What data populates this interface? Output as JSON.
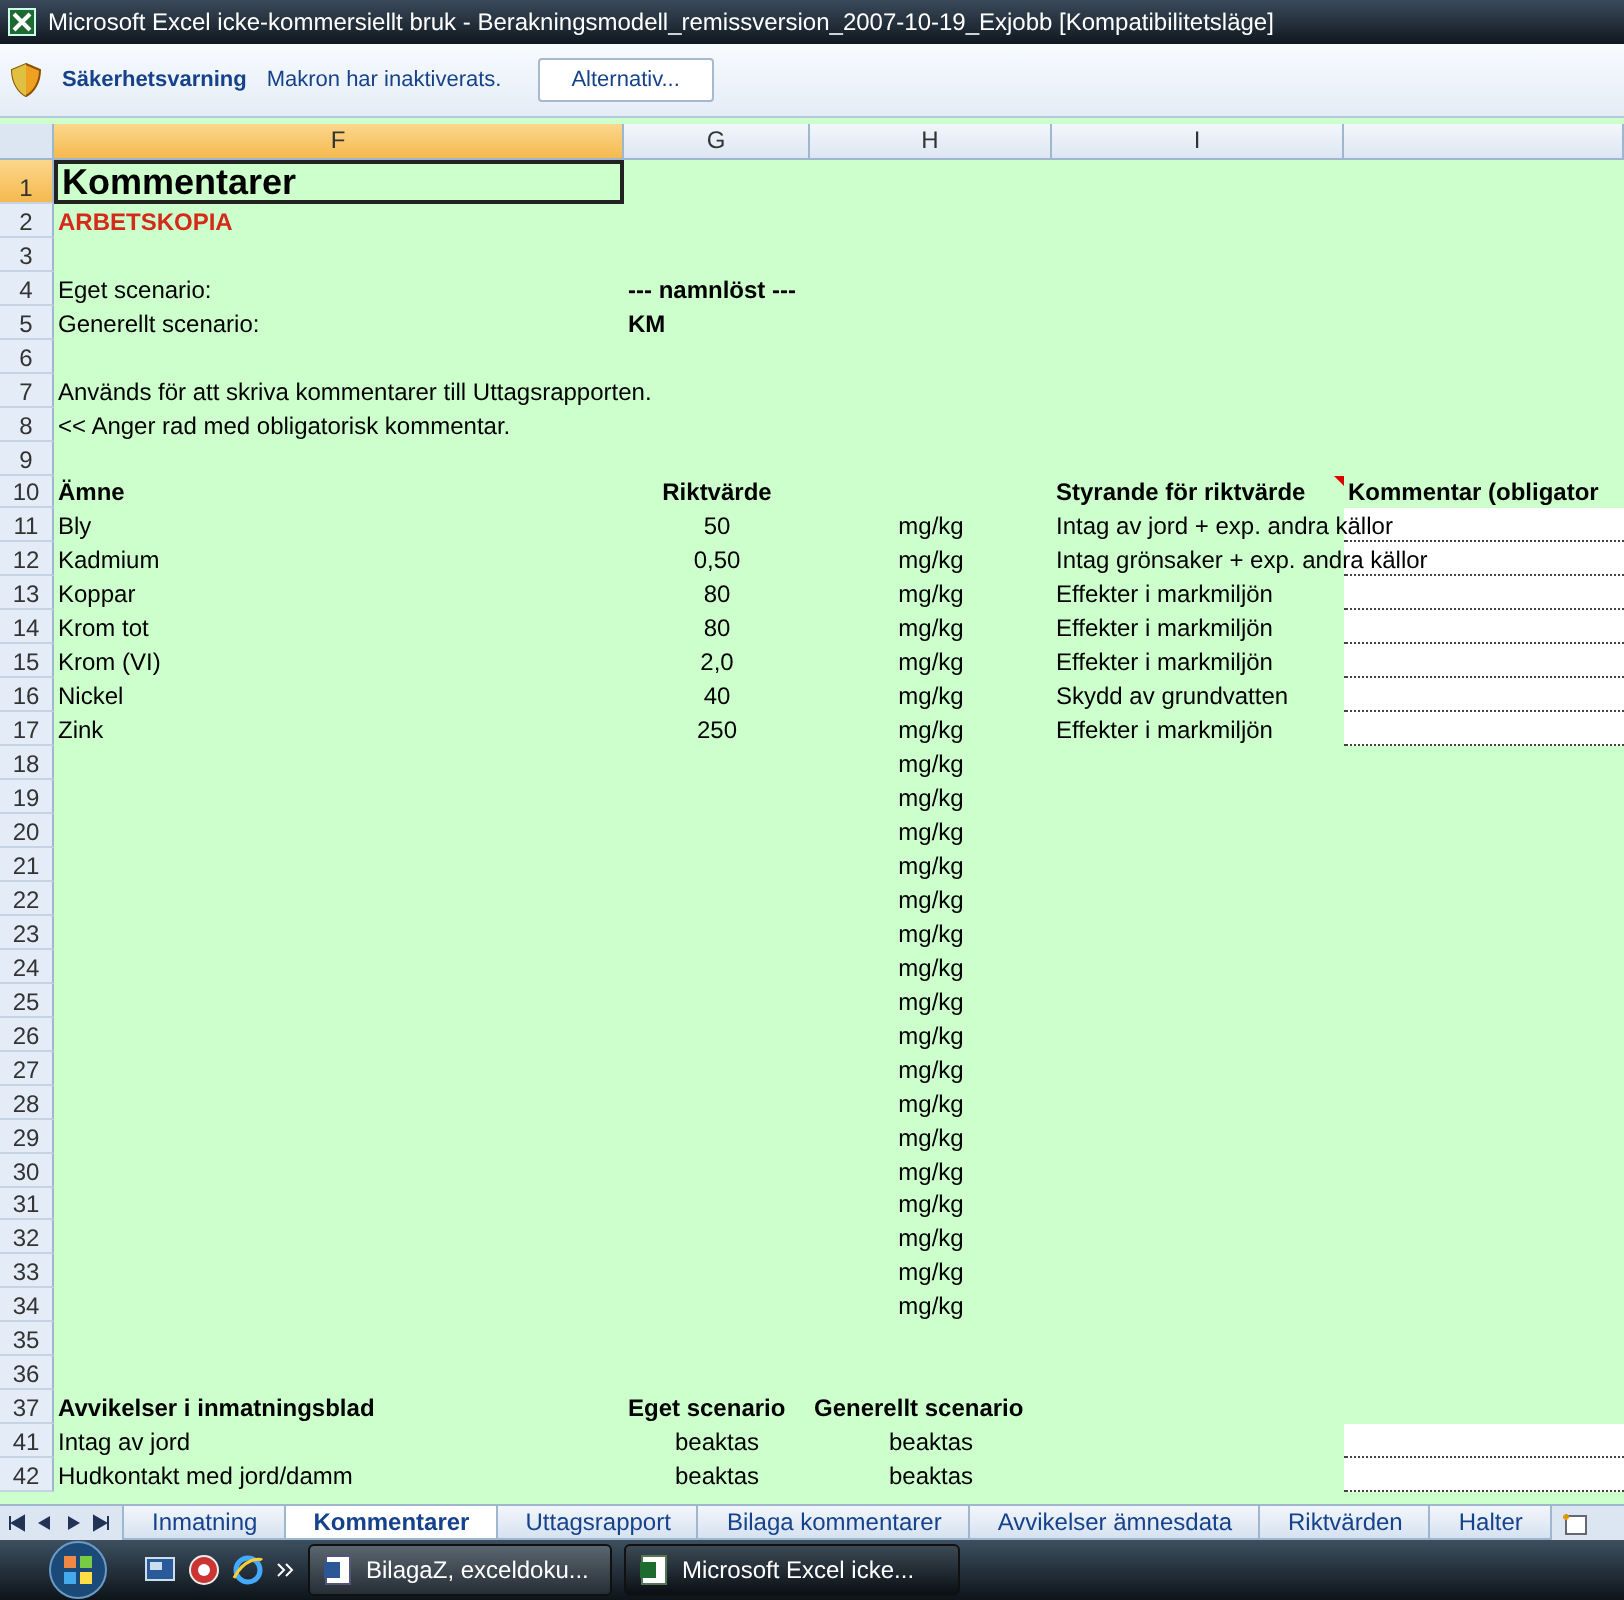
{
  "window": {
    "title": "Microsoft Excel icke-kommersiellt bruk - Berakningsmodell_remissversion_2007-10-19_Exjobb  [Kompatibilitetsläge]"
  },
  "security_bar": {
    "title": "Säkerhetsvarning",
    "message": "Makron har inaktiverats.",
    "button": "Alternativ..."
  },
  "columns": [
    {
      "label": "F",
      "selected": true
    },
    {
      "label": "G",
      "selected": false
    },
    {
      "label": "H",
      "selected": false
    },
    {
      "label": "I",
      "selected": false
    },
    {
      "selected": false
    }
  ],
  "rows": [
    {
      "n": "1",
      "kind": "title",
      "selected": true,
      "note": false,
      "comment_field": false,
      "f": "Kommentarer"
    },
    {
      "n": "2",
      "kind": "warning",
      "selected": false,
      "note": false,
      "comment_field": false,
      "f": "ARBETSKOPIA"
    },
    {
      "n": "3",
      "kind": "data",
      "selected": false,
      "note": false,
      "comment_field": false
    },
    {
      "n": "4",
      "kind": "scenario",
      "selected": false,
      "note": false,
      "comment_field": false,
      "f": "Eget scenario:",
      "g": "--- namnlöst ---"
    },
    {
      "n": "5",
      "kind": "scenario",
      "selected": false,
      "note": false,
      "comment_field": false,
      "f": "Generellt scenario:",
      "g": "KM"
    },
    {
      "n": "6",
      "kind": "data",
      "selected": false,
      "note": false,
      "comment_field": false
    },
    {
      "n": "7",
      "kind": "data",
      "selected": false,
      "note": false,
      "comment_field": false,
      "f": "Används för att skriva kommentarer till Uttagsrapporten."
    },
    {
      "n": "8",
      "kind": "data",
      "selected": false,
      "note": false,
      "comment_field": false,
      "f": "<< Anger rad med obligatorisk kommentar."
    },
    {
      "n": "9",
      "kind": "data",
      "selected": false,
      "note": false,
      "comment_field": false
    },
    {
      "n": "10",
      "kind": "header",
      "selected": false,
      "note": true,
      "comment_field": false,
      "f": "Ämne",
      "g": "Riktvärde",
      "i": "Styrande för riktvärde",
      "j": "Kommentar (obligator"
    },
    {
      "n": "11",
      "kind": "data",
      "selected": false,
      "note": false,
      "comment_field": true,
      "f": "Bly",
      "g": "50",
      "h": "mg/kg",
      "i": "Intag av jord + exp. andra källor"
    },
    {
      "n": "12",
      "kind": "data",
      "selected": false,
      "note": false,
      "comment_field": true,
      "f": "Kadmium",
      "g": "0,50",
      "h": "mg/kg",
      "i": "Intag grönsaker + exp. andra källor"
    },
    {
      "n": "13",
      "kind": "data",
      "selected": false,
      "note": false,
      "comment_field": true,
      "f": "Koppar",
      "g": "80",
      "h": "mg/kg",
      "i": "Effekter i markmiljön"
    },
    {
      "n": "14",
      "kind": "data",
      "selected": false,
      "note": false,
      "comment_field": true,
      "f": "Krom tot",
      "g": "80",
      "h": "mg/kg",
      "i": "Effekter i markmiljön"
    },
    {
      "n": "15",
      "kind": "data",
      "selected": false,
      "note": false,
      "comment_field": true,
      "f": "Krom (VI)",
      "g": "2,0",
      "h": "mg/kg",
      "i": "Effekter i markmiljön"
    },
    {
      "n": "16",
      "kind": "data",
      "selected": false,
      "note": false,
      "comment_field": true,
      "f": "Nickel",
      "g": "40",
      "h": "mg/kg",
      "i": "Skydd av grundvatten"
    },
    {
      "n": "17",
      "kind": "data",
      "selected": false,
      "note": false,
      "comment_field": true,
      "f": "Zink",
      "g": "250",
      "h": "mg/kg",
      "i": "Effekter i markmiljön"
    },
    {
      "n": "18",
      "kind": "data",
      "selected": false,
      "note": false,
      "comment_field": false,
      "h": "mg/kg"
    },
    {
      "n": "19",
      "kind": "data",
      "selected": false,
      "note": false,
      "comment_field": false,
      "h": "mg/kg"
    },
    {
      "n": "20",
      "kind": "data",
      "selected": false,
      "note": false,
      "comment_field": false,
      "h": "mg/kg"
    },
    {
      "n": "21",
      "kind": "data",
      "selected": false,
      "note": false,
      "comment_field": false,
      "h": "mg/kg"
    },
    {
      "n": "22",
      "kind": "data",
      "selected": false,
      "note": false,
      "comment_field": false,
      "h": "mg/kg"
    },
    {
      "n": "23",
      "kind": "data",
      "selected": false,
      "note": false,
      "comment_field": false,
      "h": "mg/kg"
    },
    {
      "n": "24",
      "kind": "data",
      "selected": false,
      "note": false,
      "comment_field": false,
      "h": "mg/kg"
    },
    {
      "n": "25",
      "kind": "data",
      "selected": false,
      "note": false,
      "comment_field": false,
      "h": "mg/kg"
    },
    {
      "n": "26",
      "kind": "data",
      "selected": false,
      "note": false,
      "comment_field": false,
      "h": "mg/kg"
    },
    {
      "n": "27",
      "kind": "data",
      "selected": false,
      "note": false,
      "comment_field": false,
      "h": "mg/kg"
    },
    {
      "n": "28",
      "kind": "data",
      "selected": false,
      "note": false,
      "comment_field": false,
      "h": "mg/kg"
    },
    {
      "n": "29",
      "kind": "data",
      "selected": false,
      "note": false,
      "comment_field": false,
      "h": "mg/kg"
    },
    {
      "n": "30",
      "kind": "data",
      "selected": false,
      "note": false,
      "comment_field": false,
      "h": "mg/kg"
    },
    {
      "n": "31",
      "kind": "data",
      "selected": false,
      "note": false,
      "comment_field": false,
      "h": "mg/kg"
    },
    {
      "n": "32",
      "kind": "data",
      "selected": false,
      "note": false,
      "comment_field": false,
      "h": "mg/kg"
    },
    {
      "n": "33",
      "kind": "data",
      "selected": false,
      "note": false,
      "comment_field": false,
      "h": "mg/kg"
    },
    {
      "n": "34",
      "kind": "data",
      "selected": false,
      "note": false,
      "comment_field": false,
      "h": "mg/kg"
    },
    {
      "n": "35",
      "kind": "data",
      "selected": false,
      "note": false,
      "comment_field": false
    },
    {
      "n": "36",
      "kind": "data",
      "selected": false,
      "note": false,
      "comment_field": false
    },
    {
      "n": "37",
      "kind": "header2",
      "selected": false,
      "note": false,
      "comment_field": false,
      "f": "Avvikelser i inmatningsblad",
      "g": "Eget scenario",
      "h": "Generellt scenario"
    },
    {
      "n": "41",
      "kind": "data",
      "selected": false,
      "note": false,
      "comment_field": true,
      "f": "Intag av jord",
      "g": "beaktas",
      "h": "beaktas"
    },
    {
      "n": "42",
      "kind": "data",
      "selected": false,
      "note": false,
      "comment_field": true,
      "f": "Hudkontakt med jord/damm",
      "g": "beaktas",
      "h": "beaktas"
    }
  ],
  "sheet_tabs": [
    {
      "label": "Inmatning",
      "selected": false
    },
    {
      "label": "Kommentarer",
      "selected": true
    },
    {
      "label": "Uttagsrapport",
      "selected": false
    },
    {
      "label": "Bilaga kommentarer",
      "selected": false
    },
    {
      "label": "Avvikelser ämnesdata",
      "selected": false
    },
    {
      "label": "Riktvärden",
      "selected": false
    },
    {
      "label": "Halter",
      "selected": false
    }
  ],
  "taskbar": {
    "items": [
      {
        "label": "BilagaZ, exceldoku...",
        "kind": "word",
        "selected": false
      },
      {
        "label": "Microsoft Excel icke...",
        "kind": "excel",
        "selected": true
      }
    ]
  }
}
